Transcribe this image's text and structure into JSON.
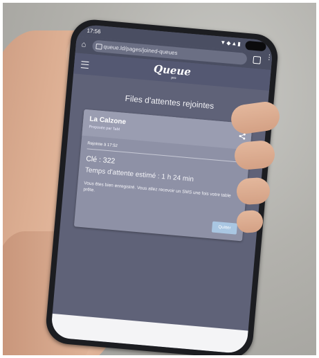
{
  "status": {
    "time": "17:56",
    "icons": "▼◆▲▮"
  },
  "browser": {
    "url": "queue.ld/pages/joined-queues"
  },
  "app": {
    "logo": "Queue",
    "logo_sub": "pro"
  },
  "page": {
    "title": "Files d'attentes rejointes"
  },
  "card": {
    "restaurant": "La Calzone",
    "proposer": "Proposée par TaM",
    "joined_at": "Rejointe à 17:52",
    "key": "Clé : 322",
    "wait": "Temps d'attente estimé : 1 h 24 min",
    "message": "Vous êtes bien enregistré. Vous allez recevoir un SMS une fois votre table prête.",
    "quit_label": "Quitter"
  }
}
